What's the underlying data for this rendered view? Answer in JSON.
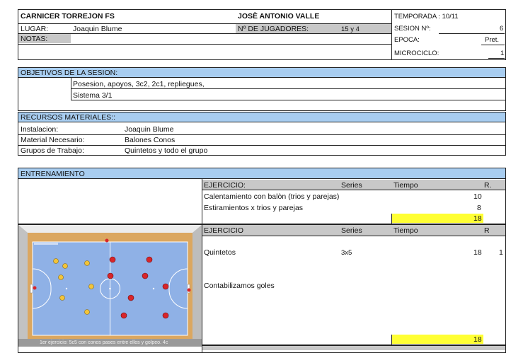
{
  "header": {
    "club": "CARNICER TORREJON FS",
    "coach": "JOSÈ ANTONIO VALLE",
    "lugar_label": "LUGAR:",
    "lugar_value": "Joaquin Blume",
    "jugadores_label": "Nº DE JUGADORES:",
    "jugadores_value": "15 y 4",
    "notas_label": "NOTAS:",
    "temporada": "TEMPORADA : 10/11",
    "sesion_label": "SESION Nº:",
    "sesion_value": "6",
    "epoca_label": "EPOCA:",
    "epoca_value": "Pret.",
    "microciclo_label": "MICROCICLO:",
    "microciclo_value": "1"
  },
  "objetivos": {
    "title": "OBJETIVOS DE LA SESION:",
    "line1": "Posesion, apoyos, 3c2, 2c1, repliegues,",
    "line2": "Sistema 3/1"
  },
  "recursos": {
    "title": "RECURSOS MATERIALES::",
    "rows": [
      {
        "label": "Instalacion:",
        "value": "Joaquin Blume"
      },
      {
        "label": "Material Necesario:",
        "value": "Balones Conos"
      },
      {
        "label": "Grupos de Trabajo:",
        "value": "Quintetos y todo el grupo"
      }
    ]
  },
  "entrenamiento": {
    "title": "ENTRENAMIENTO",
    "block1": {
      "col_ejercicio": "EJERCICIO:",
      "col_series": "Series",
      "col_tiempo": "Tiempo",
      "col_r": "R.",
      "rows": [
        {
          "name": "Calentamiento con balòn (trios y parejas)",
          "tiempo": "10"
        },
        {
          "name": "Estiramientos x trios y parejas",
          "tiempo": "8"
        }
      ],
      "total": "18"
    },
    "block2": {
      "col_ejercicio": "EJERCICIO",
      "col_series": "Series",
      "col_tiempo": "Tiempo",
      "col_r": "R",
      "name": "Quintetos",
      "series": "3x5",
      "tiempo": "18",
      "r": "1",
      "note": "Contabilizamos goles",
      "total": "18"
    },
    "diagram_caption": "1er ejercicio: 5c5 con conos pases entre ellos y golpeo. 4c"
  }
}
